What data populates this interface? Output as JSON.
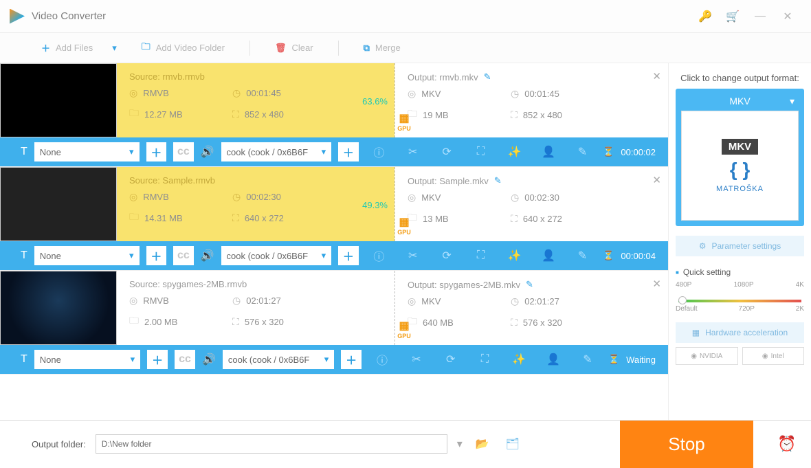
{
  "app": {
    "title": "Video Converter"
  },
  "topbar": {
    "add_files": "Add Files",
    "add_folder": "Add Video Folder",
    "clear": "Clear",
    "merge": "Merge"
  },
  "items": [
    {
      "source_label": "Source: rmvb.rmvb",
      "src_format": "RMVB",
      "src_time": "00:01:45",
      "src_size": "12.27 MB",
      "src_res": "852 x 480",
      "pct": "63.6%",
      "output_label": "Output: rmvb.mkv",
      "out_format": "MKV",
      "out_time": "00:01:45",
      "out_size": "19 MB",
      "out_res": "852 x 480",
      "sel1": "None",
      "sel2": "cook (cook / 0x6B6F",
      "status": "00:00:02",
      "highlighted": true
    },
    {
      "source_label": "Source: Sample.rmvb",
      "src_format": "RMVB",
      "src_time": "00:02:30",
      "src_size": "14.31 MB",
      "src_res": "640 x 272",
      "pct": "49.3%",
      "output_label": "Output: Sample.mkv",
      "out_format": "MKV",
      "out_time": "00:02:30",
      "out_size": "13 MB",
      "out_res": "640 x 272",
      "sel1": "None",
      "sel2": "cook (cook / 0x6B6F",
      "status": "00:00:04",
      "highlighted": true
    },
    {
      "source_label": "Source: spygames-2MB.rmvb",
      "src_format": "RMVB",
      "src_time": "02:01:27",
      "src_size": "2.00 MB",
      "src_res": "576 x 320",
      "pct": "",
      "output_label": "Output: spygames-2MB.mkv",
      "out_format": "MKV",
      "out_time": "02:01:27",
      "out_size": "640 MB",
      "out_res": "576 x 320",
      "sel1": "None",
      "sel2": "cook (cook / 0x6B6F",
      "status": "Waiting",
      "highlighted": false
    }
  ],
  "right": {
    "heading": "Click to change output format:",
    "format": "MKV",
    "matroska": "MATROŠKA",
    "param": "Parameter settings",
    "quick": "Quick setting",
    "ticks_top": [
      "480P",
      "1080P",
      "4K"
    ],
    "ticks_bot": [
      "Default",
      "720P",
      "2K"
    ],
    "hwacc": "Hardware acceleration",
    "nvidia": "NVIDIA",
    "intel": "Intel"
  },
  "footer": {
    "label": "Output folder:",
    "path": "D:\\New folder",
    "stop": "Stop"
  },
  "gpu_label": "GPU"
}
